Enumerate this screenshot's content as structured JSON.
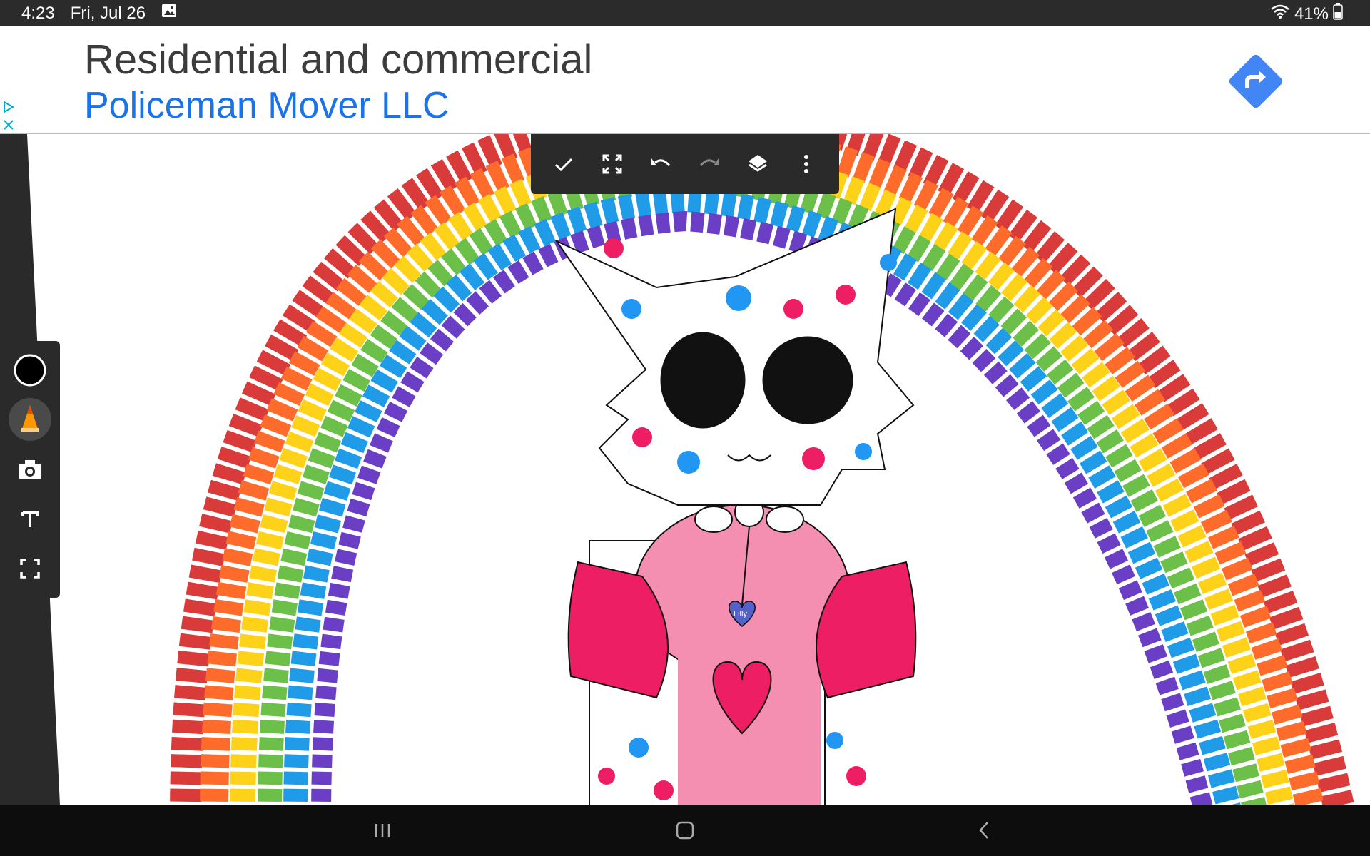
{
  "status_bar": {
    "time": "4:23",
    "date": "Fri, Jul 26",
    "battery": "41%",
    "icons": [
      "gallery-icon",
      "wifi-icon",
      "battery-icon"
    ]
  },
  "ad": {
    "headline": "Residential and commercial",
    "advertiser": "Policeman Mover LLC",
    "icons": [
      "adchoices-icon",
      "close-icon",
      "directions-icon"
    ],
    "colors": {
      "advertiser": "#1a73e8",
      "cta": "#4285f4"
    }
  },
  "toolbar": {
    "buttons": [
      "check-icon",
      "fullscreen-icon",
      "undo-icon",
      "redo-icon",
      "layers-icon",
      "more-icon"
    ]
  },
  "palette": {
    "tools": [
      "brush-color",
      "brush-tool",
      "camera",
      "text-tool",
      "fit-screen"
    ],
    "active_color": "#000000"
  },
  "drawing": {
    "label_on_charm": "Lilly",
    "colors": {
      "pink": "#ed1e64",
      "light_pink": "#f48fb1",
      "blue": "#2196f3",
      "black": "#111111"
    }
  },
  "nav_bar": {
    "buttons": [
      "recents-icon",
      "home-icon",
      "back-icon"
    ]
  }
}
